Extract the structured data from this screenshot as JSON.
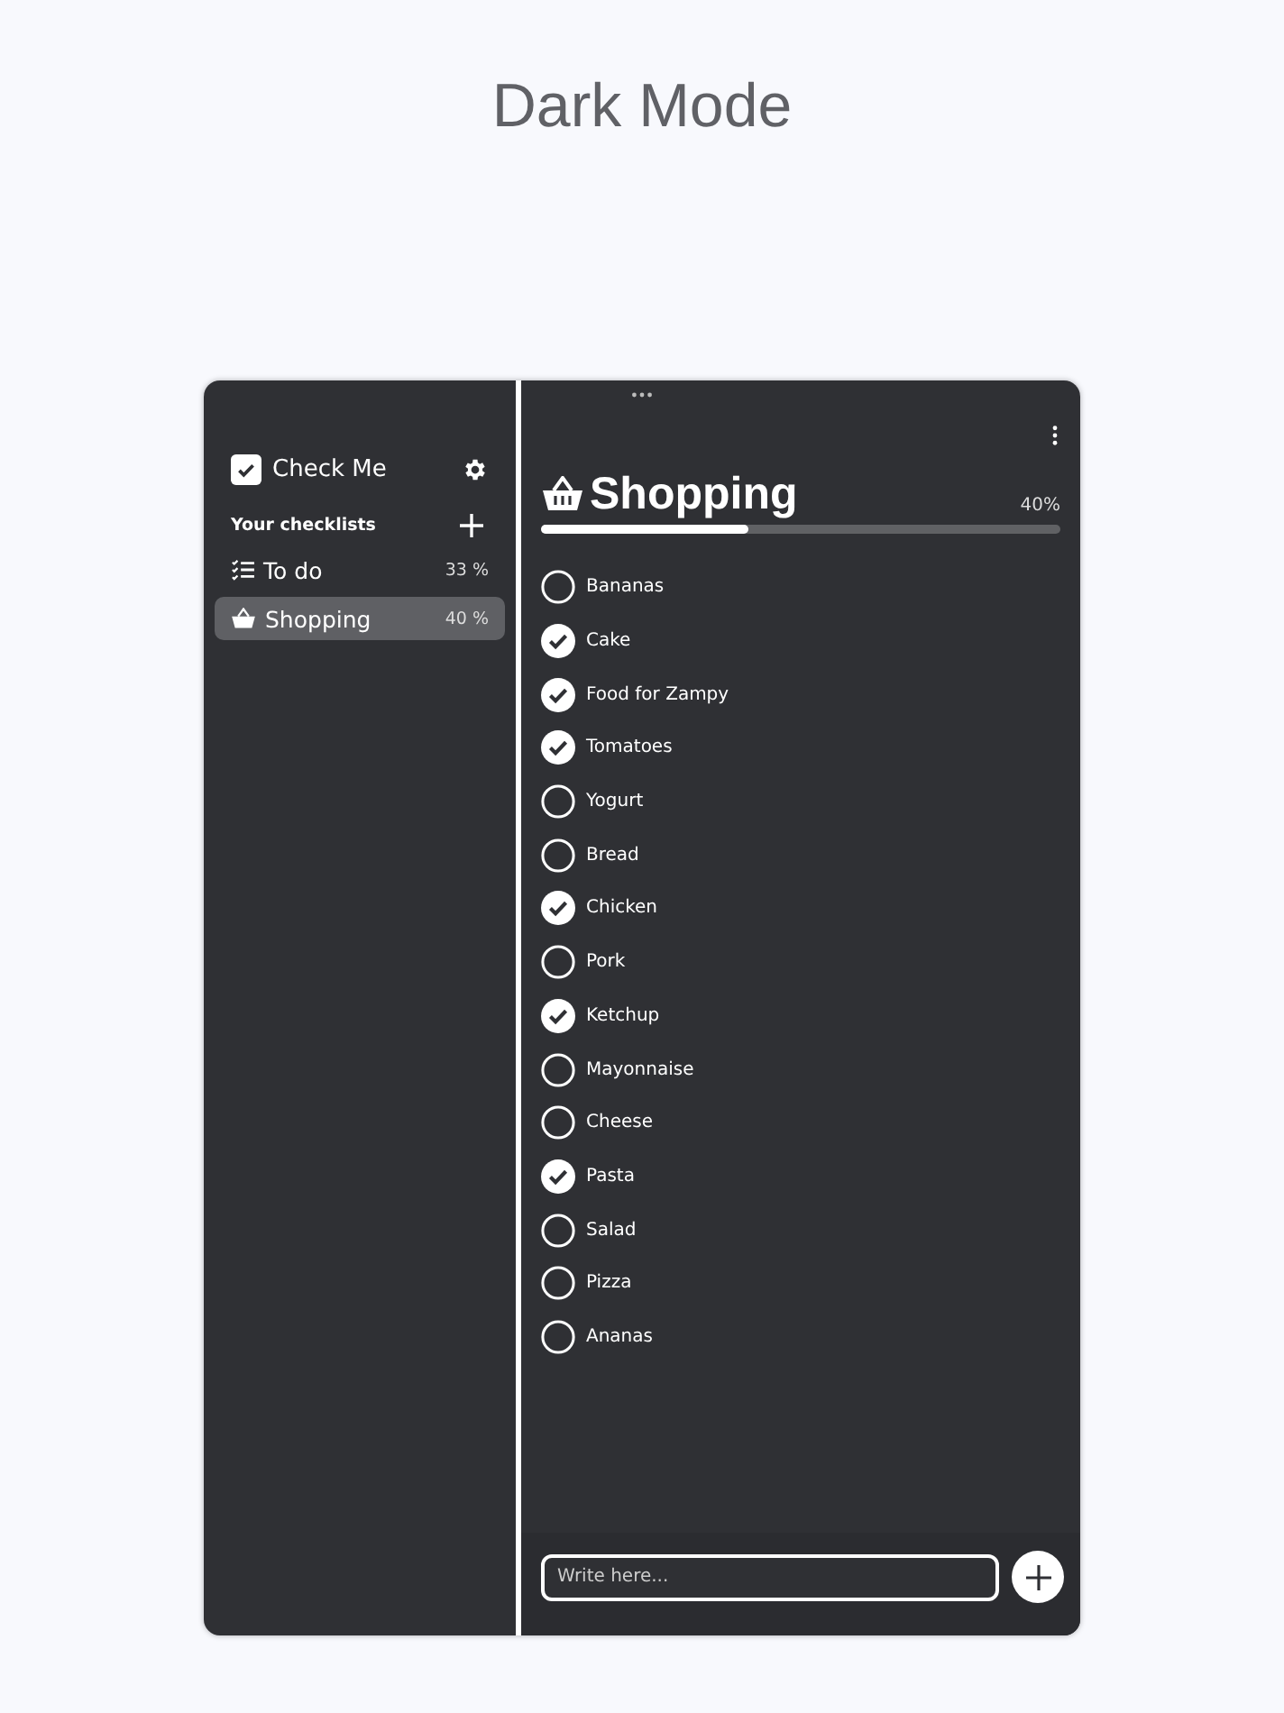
{
  "page_title": "Dark Mode",
  "sidebar": {
    "app_name": "Check Me",
    "section_title": "Your checklists",
    "lists": [
      {
        "kind": "checklist",
        "name": "To do",
        "progress": "33 %",
        "selected": false
      },
      {
        "kind": "basket",
        "name": "Shopping",
        "progress": "40 %",
        "selected": true
      }
    ]
  },
  "checklist": {
    "title": "Shopping",
    "progress": "40%",
    "level": 0.4,
    "items": [
      {
        "label": "Bananas",
        "checked": false
      },
      {
        "label": "Cake",
        "checked": true
      },
      {
        "label": "Food for Zampy",
        "checked": true
      },
      {
        "label": "Tomatoes",
        "checked": true
      },
      {
        "label": "Yogurt",
        "checked": false
      },
      {
        "label": "Bread",
        "checked": false
      },
      {
        "label": "Chicken",
        "checked": true
      },
      {
        "label": "Pork",
        "checked": false
      },
      {
        "label": "Ketchup",
        "checked": true
      },
      {
        "label": "Mayonnaise",
        "checked": false
      },
      {
        "label": "Cheese",
        "checked": false
      },
      {
        "label": "Pasta",
        "checked": true
      },
      {
        "label": "Salad",
        "checked": false
      },
      {
        "label": "Pizza",
        "checked": false
      },
      {
        "label": "Ananas",
        "checked": false
      }
    ]
  },
  "composer": {
    "placeholder": "Write here..."
  }
}
